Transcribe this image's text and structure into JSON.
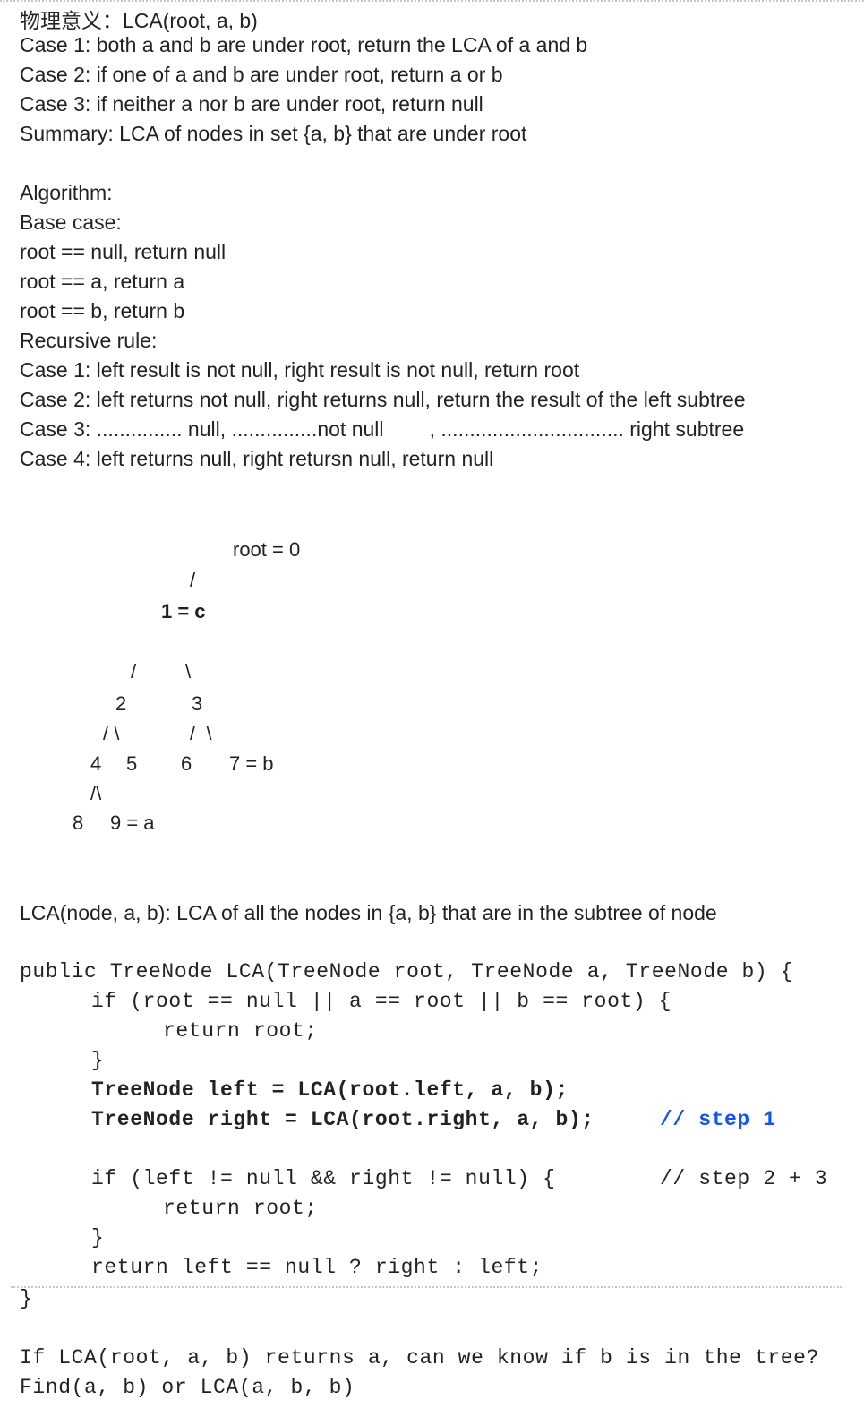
{
  "notes": {
    "title": "物理意义：LCA(root, a, b)",
    "cases": [
      "Case 1: both a and b are under root, return the LCA of a and b",
      "Case 2: if one of a and b are under root, return a or b",
      "Case 3: if neither a nor b are under root, return null",
      "Summary: LCA of nodes in set {a, b} that are under root"
    ]
  },
  "algorithm": {
    "heading": "Algorithm:",
    "base_heading": "Base case:",
    "base_cases": [
      "root == null, return null",
      "root == a, return a",
      "root == b, return b"
    ],
    "recursive_heading": "Recursive rule:",
    "rules": [
      "Case 1: left result is not null, right result is not null, return root",
      "Case 2: left returns not null, right returns null, return the result of the left subtree",
      "Case 3: ............... null, ...............not null        , ................................ right subtree",
      "Case 4: left returns null, right retursn null, return null"
    ]
  },
  "tree": {
    "root_label": "root = 0",
    "edge_root": "/",
    "node1": "1 = c",
    "edge1_left": "/",
    "edge1_right": "\\",
    "node2": "2",
    "node3": "3",
    "edge2": "/ \\",
    "edge3": "/  \\",
    "node4": "4",
    "node5": "5",
    "node6": "6",
    "node7": "7 = b",
    "edge4": "/\\",
    "node8": "8",
    "node9": "9 = a"
  },
  "definition": "LCA(node, a, b): LCA of all the nodes in {a, b} that are in the subtree of node",
  "code": {
    "l1": "public TreeNode LCA(TreeNode root, TreeNode a, TreeNode b) {",
    "l2": "if (root == null || a == root || b == root) {",
    "l3": "return root;",
    "l4": "}",
    "l5": "TreeNode left = LCA(root.left, a, b);",
    "l6": "TreeNode right = LCA(root.right, a, b);",
    "c6": "// step 1",
    "l7": "if (left != null && right != null) {",
    "c7": "// step 2 + 3",
    "l8": "return root;",
    "l9": "}",
    "l10": "return left == null ? right : left;",
    "l11": "}"
  },
  "question": {
    "q1": "If LCA(root, a, b) returns a, can we know if b is in the tree?",
    "q2": "Find(a, b) or LCA(a, b, b)"
  },
  "colors": {
    "accent": "#1155ee",
    "text": "#222222",
    "divider": "#c8c8c8"
  }
}
